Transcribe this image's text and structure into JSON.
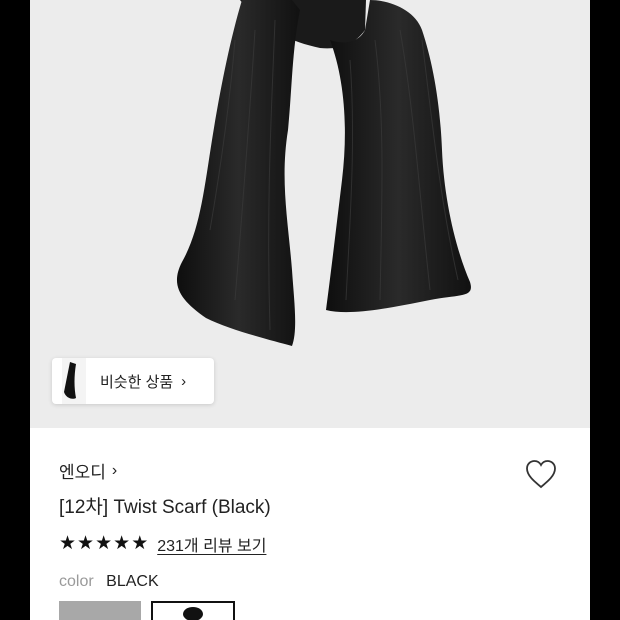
{
  "similar_products": {
    "label": "비슷한 상품",
    "chevron": "›"
  },
  "brand": {
    "name": "엔오디",
    "chevron": "›"
  },
  "product": {
    "title": "[12차] Twist Scarf (Black)"
  },
  "rating": {
    "stars": 5,
    "star_glyph": "★",
    "review_link": "231개 리뷰 보기"
  },
  "color": {
    "key": "color",
    "value": "BLACK"
  },
  "icons": {
    "wishlist": "heart-outline-icon"
  },
  "colors": {
    "hero_bg": "#ececec",
    "scarf": "#1b1b1b",
    "swatch_selected_border": "#111111",
    "swatch_gray": "#a8a8a8"
  }
}
